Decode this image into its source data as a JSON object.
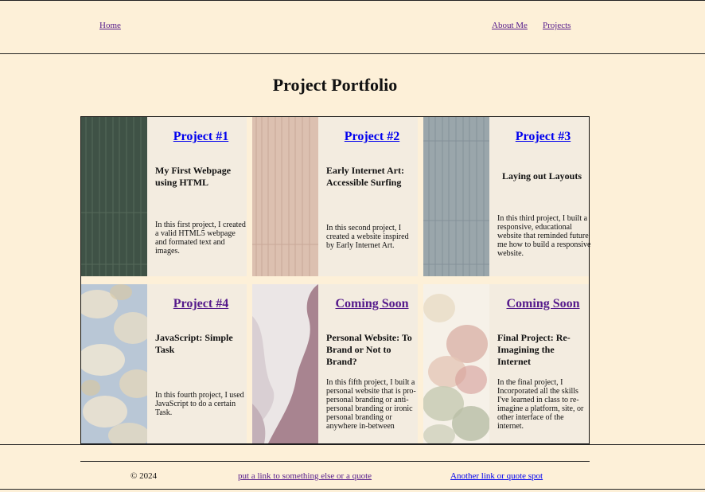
{
  "nav": {
    "home": "Home",
    "about": "About Me",
    "projects": "Projects"
  },
  "page_title": "Project Portfolio",
  "cards": [
    {
      "title": "Project #1",
      "subtitle": "My First Webpage using HTML",
      "description": "In this first project, I created a valid HTML5 webpage and formated text and images.",
      "thumb_color": "#3f5246"
    },
    {
      "title": "Project #2",
      "subtitle": "Early Internet Art: Accessible Surfing",
      "description": "In this second project, I created a website inspired by Early Internet Art.",
      "thumb_color": "#dcc0b0"
    },
    {
      "title": "Project #3",
      "subtitle": "Laying out Layouts",
      "description": "In this third project, I built a responsive, educational website that reminded future me how to build a responsive website.",
      "thumb_color": "#9aa6ab"
    },
    {
      "title": "Project #4",
      "subtitle": "JavaScript: Simple Task",
      "description": "In this fourth project, I used JavaScript to do a certain Task.",
      "thumb_color": "#b9c7d6"
    },
    {
      "title": "Coming Soon",
      "subtitle": "Personal Website: To Brand or Not to Brand?",
      "description": "In this fifth project, I built a personal website that is pro-personal branding or anti-personal branding or ironic personal branding or anywhere in-between",
      "thumb_color": "#a88490"
    },
    {
      "title": "Coming Soon",
      "subtitle": "Final Project: Re-Imagining the Internet",
      "description": "In the final project, I Incorporated all the skills I've learned in class to re-imagine a platform, site, or other interface of the internet.",
      "thumb_color": "#d8b7a8"
    }
  ],
  "footer": {
    "copyright": "© 2024",
    "link1": "put a link to something else or a quote",
    "link2": "Another link or quote spot"
  }
}
